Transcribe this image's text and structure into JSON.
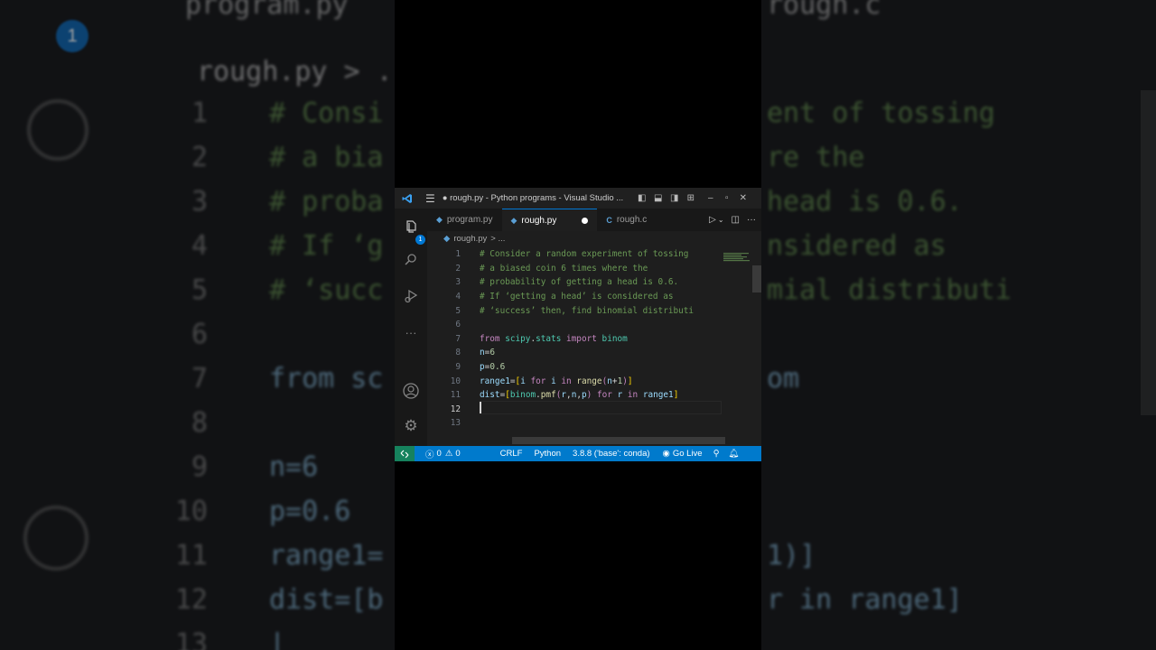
{
  "window": {
    "title": "● rough.py - Python programs - Visual Studio ..."
  },
  "tabs": [
    {
      "label": "program.py",
      "icon": "python-icon"
    },
    {
      "label": "rough.py",
      "icon": "python-icon",
      "active": true,
      "modified": true
    },
    {
      "label": "rough.c",
      "icon": "c-icon",
      "icon_text": "C"
    }
  ],
  "activity": {
    "explorer_badge": "1"
  },
  "breadcrumb": {
    "file": "rough.py",
    "separator": "> ..."
  },
  "editor": {
    "lines": [
      {
        "n": "1",
        "text": "# Consider a random experiment of tossing"
      },
      {
        "n": "2",
        "text": "# a biased coin 6 times where the"
      },
      {
        "n": "3",
        "text": "# probability of getting a head is 0.6."
      },
      {
        "n": "4",
        "text": "# If ‘getting a head’ is considered as"
      },
      {
        "n": "5",
        "text": "# ‘success’ then, find binomial distributi"
      },
      {
        "n": "6",
        "text": ""
      },
      {
        "n": "7",
        "text": "from scipy.stats import binom"
      },
      {
        "n": "8",
        "text": "n=6"
      },
      {
        "n": "9",
        "text": "p=0.6"
      },
      {
        "n": "10",
        "text": "range1=[i for i in range(n+1)]"
      },
      {
        "n": "11",
        "text": "dist=[binom.pmf(r,n,p) for r in range1]"
      },
      {
        "n": "12",
        "text": ""
      },
      {
        "n": "13",
        "text": ""
      }
    ],
    "current_line": "12"
  },
  "statusbar": {
    "errors": "0",
    "warnings": "0",
    "eol": "CRLF",
    "language": "Python",
    "interpreter": "3.8.8 ('base': conda)",
    "live": "Go Live"
  },
  "background": {
    "left_tab": "program.py",
    "left_breadcrumb": "rough.py > ...",
    "left_badge": "1",
    "right_tab": "rough.c",
    "left_nums": [
      "1",
      "2",
      "3",
      "4",
      "5",
      "6",
      "7",
      "8",
      "9",
      "10",
      "11",
      "12",
      "13"
    ],
    "left_lines": [
      "# Consi",
      "# a bia",
      "# proba",
      "# If ‘g",
      "# ‘succ",
      "",
      "from sc",
      "",
      "n=6",
      "p=0.6",
      "range1=",
      "dist=[b",
      "|"
    ],
    "right_lines": [
      "ent of tossing",
      "re the",
      "head is 0.6.",
      "nsidered as",
      "mial distributi",
      "",
      "om",
      "",
      "",
      "",
      "1)]",
      "r in range1]"
    ]
  }
}
